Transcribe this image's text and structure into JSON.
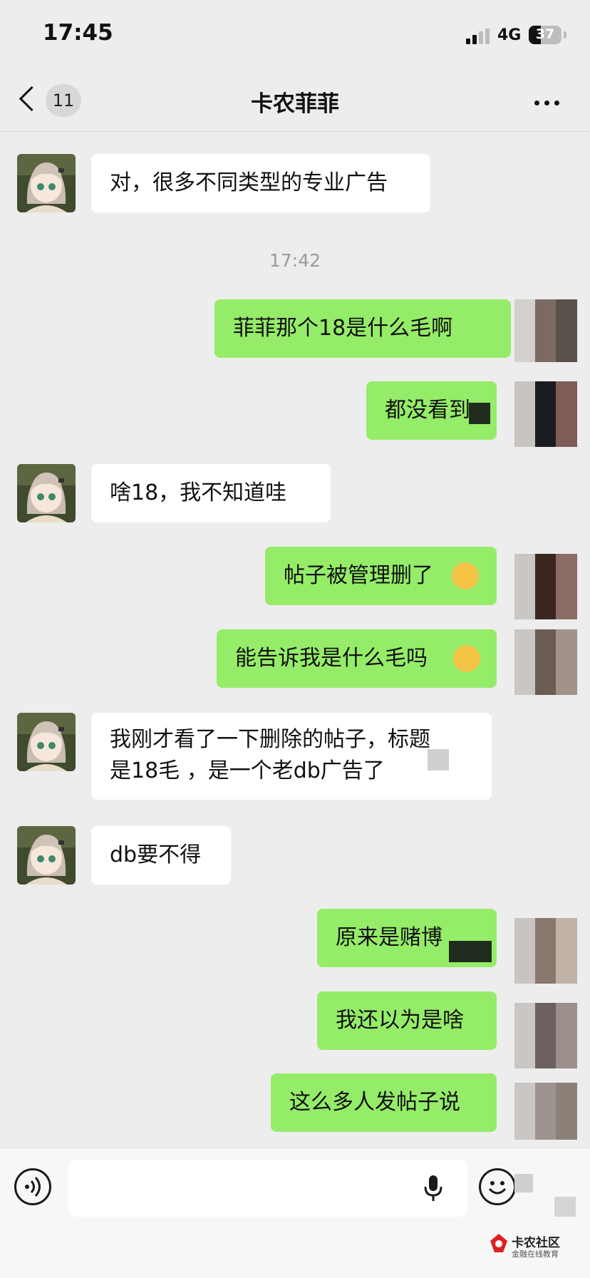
{
  "status_bar": {
    "time": "17:45",
    "network": "4G",
    "battery": "37",
    "battery_level": 0.37
  },
  "nav": {
    "unread_count": "11",
    "title": "卡农菲菲"
  },
  "timestamp": "17:42",
  "messages": [
    {
      "side": "in",
      "text": "对，很多不同类型的专业广告"
    },
    {
      "side": "out",
      "text": "菲菲那个18是什么毛啊"
    },
    {
      "side": "out",
      "text": "都没看到"
    },
    {
      "side": "in",
      "text": "啥18，我不知道哇"
    },
    {
      "side": "out",
      "text": "帖子被管理删了"
    },
    {
      "side": "out",
      "text": "能告诉我是什么毛吗"
    },
    {
      "side": "in",
      "lines": [
        "我刚才看了一下删除的帖子，标题",
        "是18毛 ，是一个老db广告了"
      ]
    },
    {
      "side": "in",
      "text": "db要不得"
    },
    {
      "side": "out",
      "text": "原来是赌博"
    },
    {
      "side": "out",
      "text": "我还以为是啥"
    },
    {
      "side": "out",
      "text": "这么多人发帖子说"
    }
  ],
  "input": {
    "placeholder": ""
  },
  "icons": {
    "back": "chevron-left-icon",
    "more": "more-dots-icon",
    "voice": "voice-icon",
    "mic": "mic-icon",
    "emoji": "emoji-icon",
    "cry_laugh": "face-with-tears-of-joy",
    "pleading": "pleading-face"
  },
  "watermark": {
    "name": "卡农社区",
    "tagline": "金融在线教育"
  },
  "colors": {
    "background": "#ededed",
    "bubble_out": "#95ec69",
    "bubble_in": "#ffffff",
    "watermark_red": "#e02020"
  }
}
